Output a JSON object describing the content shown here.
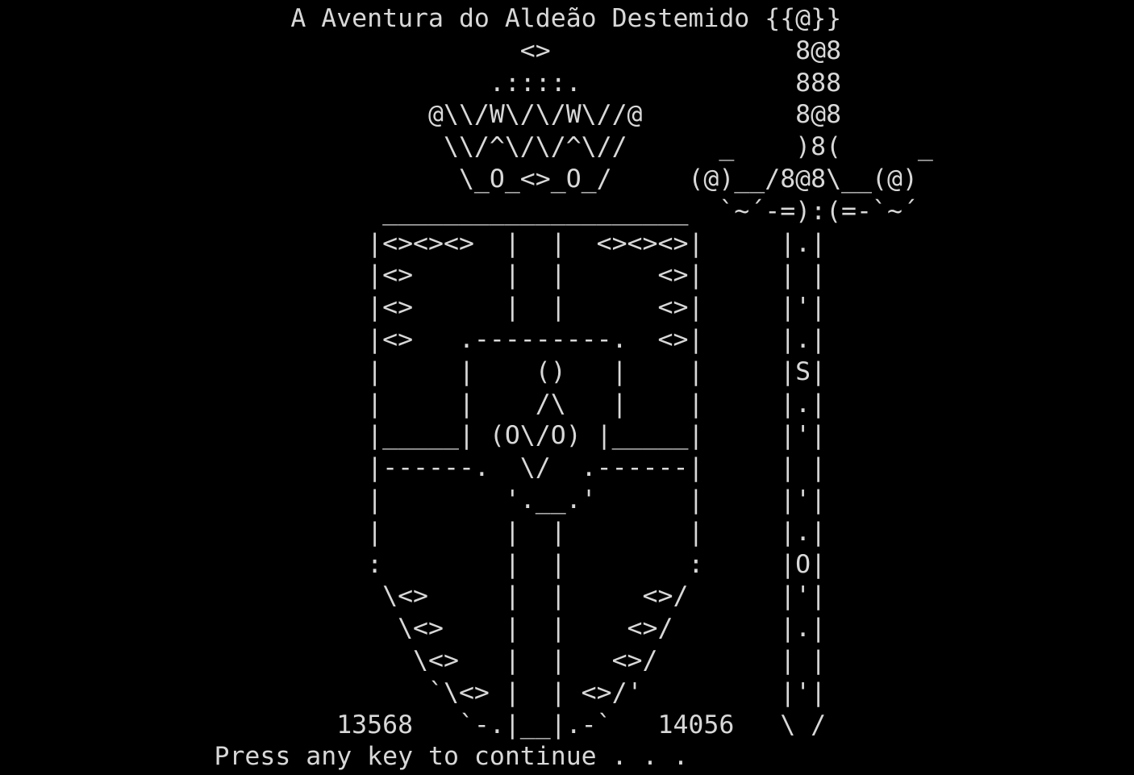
{
  "window": {
    "background": "#000000",
    "foreground": "#d8d8d8"
  },
  "console": {
    "lines": [
      "                   A Aventura do Aldeão Destemido {{@}}",
      "                                  <>                8@8",
      "                                .::::.              888",
      "                            @\\\\/W\\/\\/W\\//@          8@8",
      "                             \\\\/^\\/\\/^\\//      _    )8(     _",
      "                              \\_O_<>_O_/     (@)__/8@8\\__(@)",
      "                         ____________________  `~´-=):(=-`~´",
      "                        |<><><>  |  |  <><><>|     |.|",
      "                        |<>      |  |      <>|     | |",
      "                        |<>      |  |      <>|     |'|",
      "                        |<>   .---------.  <>|     |.|",
      "                        |     |    ()   |    |     |S|",
      "                        |     |    /\\   |    |     |.|",
      "                        |_____| (O\\/O) |_____|     |'|",
      "                        |------.  \\/  .------|     | |",
      "                        |        '.__.'      |     |'|",
      "                        |        |  |        |     |.|",
      "                        :        |  |        :     |O|",
      "                         \\<>     |  |     <>/      |'|",
      "                          \\<>    |  |    <>/       |.|",
      "                           \\<>   |  |   <>/        | |",
      "                            `\\<> |  | <>/'         |'|",
      "                      13568   `-.|__|.-`   14056   \\ /",
      "              Press any key to continue . . ."
    ]
  }
}
